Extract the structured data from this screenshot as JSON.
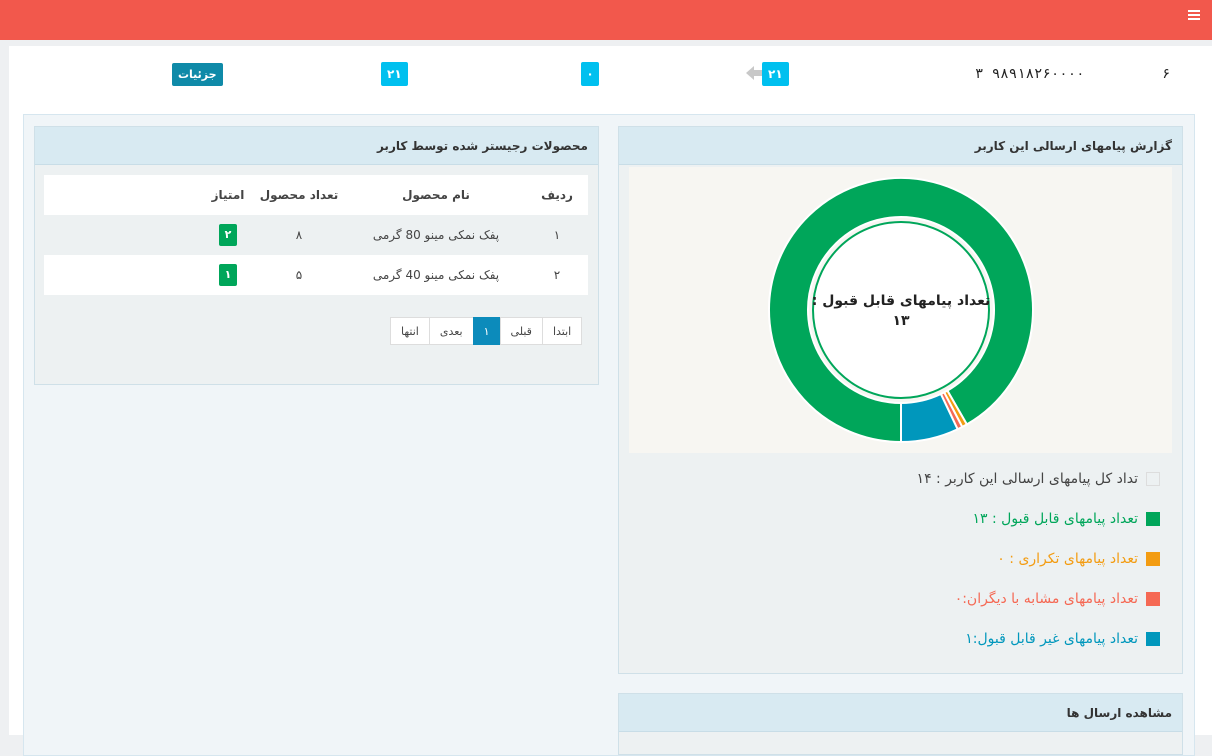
{
  "header": {
    "menu_icon": "hamburger-icon"
  },
  "info_row": {
    "index": "۶",
    "phone": "۹۸۹۱۸۲۶۰۰۰۰ ۳",
    "sent_count": "۲۱",
    "zero_count": "۰",
    "total_count": "۲۱",
    "details_label": "جزئیات"
  },
  "products_panel": {
    "title": "محصولات رجیستر شده توسط کاربر",
    "columns": [
      "ردیف",
      "نام محصول",
      "تعداد محصول",
      "امتیاز"
    ],
    "rows": [
      {
        "row": "۱",
        "name": "پفک نمکی مینو 80 گرمی",
        "qty": "۸",
        "score": "۲"
      },
      {
        "row": "۲",
        "name": "پفک نمکی مینو 40 گرمی",
        "qty": "۵",
        "score": "۱"
      }
    ],
    "pager": [
      "ابتدا",
      "قبلی",
      "۱",
      "بعدی",
      "انتها"
    ]
  },
  "report_panel": {
    "title": "گزارش پیامهای ارسالی این کاربر",
    "center_line1": "تعداد پیامهای قابل قبول :",
    "center_line2": "۱۳",
    "legend": [
      {
        "text": "تداد کل پیامهای ارسالی این کاربر : ۱۴",
        "color": "#ffffff",
        "text_color": "#444444"
      },
      {
        "text": "تعداد پیامهای قابل قبول : ۱۳",
        "color": "#00a65a",
        "text_color": "#00a65a"
      },
      {
        "text": "تعداد پیامهای تکراری : ۰",
        "color": "#f39c12",
        "text_color": "#f39c12"
      },
      {
        "text": "تعداد پیامهای مشابه با دیگران:۰",
        "color": "#f56954",
        "text_color": "#f56954"
      },
      {
        "text": "تعداد پیامهای غیر قابل قبول:۱",
        "color": "#0097bc",
        "text_color": "#0097bc"
      }
    ]
  },
  "sends_panel": {
    "title": "مشاهده ارسال ها"
  },
  "chart_data": {
    "type": "pie",
    "labels": [
      "قابل قبول",
      "تکراری",
      "مشابه با دیگران",
      "غیر قابل قبول"
    ],
    "values": [
      13,
      0,
      0,
      1
    ],
    "colors": [
      "#00a65a",
      "#f39c12",
      "#f56954",
      "#0097bc"
    ]
  }
}
